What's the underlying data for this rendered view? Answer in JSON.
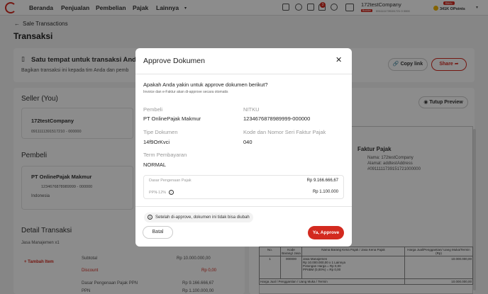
{
  "nav": {
    "links": [
      "Beranda",
      "Penjualan",
      "Pembelian",
      "Pajak",
      "Lainnya"
    ],
    "notification_count": "3",
    "company_name": "172testCompany",
    "company_badge": "Booklet",
    "company_npwp": "0911111739151721 0 0000",
    "new_badge": "Baru",
    "points": "341K OPoints"
  },
  "page": {
    "back_label": "Sale Transactions",
    "title": "Transaksi"
  },
  "share_card": {
    "title": "Satu tempat untuk transaksi And",
    "subtitle": "Bagikan transaksi ini kepada tim Anda dan pemb",
    "copy_link": "Copy link",
    "share": "Share"
  },
  "seller": {
    "heading": "Seller (You)",
    "name": "172testCompany",
    "npwp": "0911111391517210 - 000000",
    "preview_button": "Tutup Preview"
  },
  "buyer": {
    "heading": "Pembeli",
    "name": "PT OnlinePajak Makmur",
    "npwp": "1234676878989999 - 000000",
    "country": "Indonesia"
  },
  "detail": {
    "heading": "Detail Transaksi",
    "item": "Jasa Manajemen x1",
    "add_item": "Tambah Item",
    "rows": [
      {
        "label": "Subtotal",
        "value": "Rp 10.000.000,00"
      },
      {
        "label": "Discount",
        "value": "Rp 0,00"
      },
      {
        "label": "Dasar Pengenaan Pajak PPN",
        "value": "Rp 9.166.666,67"
      },
      {
        "label": "PPN",
        "value": "Rp 1.100.000,00"
      }
    ]
  },
  "preview_doc": {
    "title": "Faktur Pajak",
    "seller_lines": [
      "Nama: 172testCompany",
      "Alamat: addtestAddress",
      "#0911111739151721000000"
    ],
    "headers": [
      "No.",
      "Kode Barang/ Jasa",
      "Nama Barang Kena Pajak / Jasa Kena Pajak",
      "Harga Jual/Penggantian/ Uang Muka/Termin (Rp)"
    ],
    "row": {
      "no": "1",
      "code": "000000",
      "desc": [
        "Jasa Manajemen",
        "Rp 10.000.000,00 x 1 Lainnya",
        "Potongan Harga = Rp 0,00",
        "PPnBM (0,00%) = Rp 0,00"
      ],
      "amount": "10.000.000,00"
    },
    "footer_label": "Harga Jual / Penggantian / Uang Muka / Termin",
    "footer_value": "10.000.000,00"
  },
  "modal": {
    "title": "Approve Dokumen",
    "question": "Apakah Anda yakin untuk approve dokumen berikut?",
    "subtext": "Invoice dan e-Faktur akan di-approve secara otomatis",
    "fields": [
      {
        "label": "Pembeli",
        "value": "PT OnlinePajak Makmur"
      },
      {
        "label": "NITKU",
        "value": "1234676878989999-000000"
      },
      {
        "label": "Tipe Dokumen",
        "value": "14f9OrKvci"
      },
      {
        "label": "Kode dan Nomor Seri Faktur Pajak",
        "value": "040"
      },
      {
        "label": "Term Pembayaran",
        "value": "NORMAL"
      }
    ],
    "summary": [
      {
        "label": "Dasar Pengenaan Pajak",
        "value": "Rp 9.166.666,67"
      },
      {
        "label": "PPN-12%",
        "value": "Rp 1.100.000"
      }
    ],
    "warning": "Setelah di-approve, dokumen ini tidak bisa diubah",
    "cancel": "Batal",
    "confirm": "Ya, Approve"
  },
  "colors": {
    "accent": "#d32a1f"
  }
}
